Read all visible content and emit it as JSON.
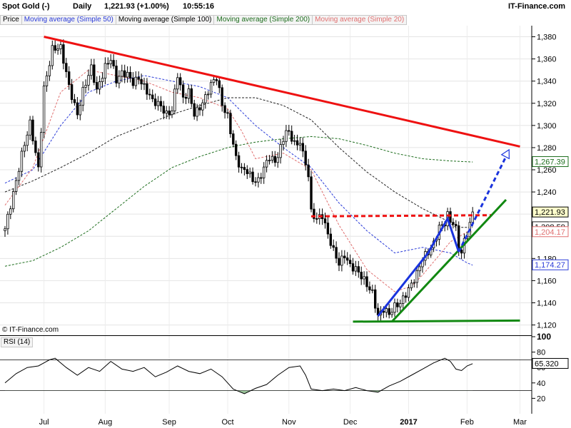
{
  "header": {
    "instrument": "Spot Gold (-)",
    "interval": "Daily",
    "quote": "1,221.93 (+1.00%)",
    "time": "10:55:16",
    "brand": "IT-Finance.com"
  },
  "legend": [
    {
      "label": "Price",
      "color": "#000000"
    },
    {
      "label": "Moving average (Simple 50)",
      "color": "#2a3bd8"
    },
    {
      "label": "Moving average (Simple 100)",
      "color": "#000000"
    },
    {
      "label": "Moving average (Simple 200)",
      "color": "#1e6e1e"
    },
    {
      "label": "Moving average (Simple 20)",
      "color": "#e07070"
    }
  ],
  "copyright": "© IT-Finance.com",
  "rsi_label": "RSI (14)",
  "chart_data": [
    {
      "type": "candlestick",
      "title": "Spot Gold (-) Daily",
      "ylim": [
        1112,
        1390
      ],
      "y_ticks": [
        1120,
        1140,
        1160,
        1180,
        1200,
        1220,
        1240,
        1260,
        1280,
        1300,
        1320,
        1340,
        1360,
        1380
      ],
      "y_tick_labels": [
        "1,120",
        "1,140",
        "1,160",
        "1,180",
        "",
        "",
        "1,240",
        "1,260",
        "1,280",
        "1,300",
        "1,320",
        "1,340",
        "1,360",
        "1,380"
      ],
      "x_labels": [
        {
          "label": "Jul",
          "day": 14
        },
        {
          "label": "Aug",
          "day": 36
        },
        {
          "label": "Sep",
          "day": 59
        },
        {
          "label": "Oct",
          "day": 80
        },
        {
          "label": "Nov",
          "day": 102
        },
        {
          "label": "Dec",
          "day": 124
        },
        {
          "label": "2017",
          "day": 145
        },
        {
          "label": "Feb",
          "day": 166
        },
        {
          "label": "Mar",
          "day": 185
        }
      ],
      "last_day": 168,
      "close_keys": [
        [
          0,
          1205
        ],
        [
          3,
          1240
        ],
        [
          6,
          1275
        ],
        [
          9,
          1300
        ],
        [
          12,
          1260
        ],
        [
          14,
          1335
        ],
        [
          17,
          1370
        ],
        [
          20,
          1368
        ],
        [
          23,
          1335
        ],
        [
          26,
          1312
        ],
        [
          28,
          1332
        ],
        [
          31,
          1350
        ],
        [
          33,
          1330
        ],
        [
          36,
          1355
        ],
        [
          38,
          1362
        ],
        [
          40,
          1340
        ],
        [
          42,
          1345
        ],
        [
          44,
          1345
        ],
        [
          46,
          1340
        ],
        [
          48,
          1345
        ],
        [
          50,
          1335
        ],
        [
          53,
          1320
        ],
        [
          56,
          1318
        ],
        [
          58,
          1312
        ],
        [
          60,
          1315
        ],
        [
          62,
          1345
        ],
        [
          64,
          1322
        ],
        [
          66,
          1330
        ],
        [
          68,
          1312
        ],
        [
          70,
          1318
        ],
        [
          72,
          1325
        ],
        [
          74,
          1335
        ],
        [
          76,
          1342
        ],
        [
          78,
          1320
        ],
        [
          80,
          1310
        ],
        [
          83,
          1270
        ],
        [
          85,
          1258
        ],
        [
          87,
          1258
        ],
        [
          89,
          1252
        ],
        [
          91,
          1252
        ],
        [
          93,
          1262
        ],
        [
          95,
          1270
        ],
        [
          97,
          1265
        ],
        [
          99,
          1280
        ],
        [
          101,
          1298
        ],
        [
          103,
          1290
        ],
        [
          105,
          1280
        ],
        [
          106,
          1285
        ],
        [
          107,
          1272
        ],
        [
          109,
          1255
        ],
        [
          110,
          1222
        ],
        [
          112,
          1218
        ],
        [
          114,
          1220
        ],
        [
          116,
          1200
        ],
        [
          118,
          1185
        ],
        [
          120,
          1175
        ],
        [
          122,
          1185
        ],
        [
          124,
          1175
        ],
        [
          126,
          1170
        ],
        [
          128,
          1162
        ],
        [
          130,
          1155
        ],
        [
          132,
          1150
        ],
        [
          133,
          1140
        ],
        [
          134,
          1130
        ],
        [
          136,
          1135
        ],
        [
          138,
          1128
        ],
        [
          140,
          1135
        ],
        [
          142,
          1140
        ],
        [
          144,
          1150
        ],
        [
          146,
          1158
        ],
        [
          148,
          1165
        ],
        [
          150,
          1178
        ],
        [
          152,
          1185
        ],
        [
          154,
          1195
        ],
        [
          156,
          1210
        ],
        [
          158,
          1212
        ],
        [
          159,
          1218
        ],
        [
          160,
          1212
        ],
        [
          161,
          1210
        ],
        [
          162,
          1205
        ],
        [
          163,
          1190
        ],
        [
          164,
          1185
        ],
        [
          165,
          1198
        ],
        [
          166,
          1205
        ],
        [
          167,
          1212
        ],
        [
          168,
          1222
        ]
      ],
      "series": [
        {
          "name": "Moving average (Simple 50)",
          "color": "#2a3bd8",
          "dash": "3,2",
          "points": [
            [
              0,
              1248
            ],
            [
              10,
              1260
            ],
            [
              20,
              1300
            ],
            [
              30,
              1330
            ],
            [
              40,
              1340
            ],
            [
              50,
              1345
            ],
            [
              60,
              1340
            ],
            [
              70,
              1335
            ],
            [
              80,
              1325
            ],
            [
              90,
              1300
            ],
            [
              100,
              1280
            ],
            [
              110,
              1262
            ],
            [
              120,
              1230
            ],
            [
              130,
              1205
            ],
            [
              140,
              1185
            ],
            [
              150,
              1190
            ],
            [
              160,
              1185
            ],
            [
              166,
              1176
            ],
            [
              168,
              1174
            ]
          ]
        },
        {
          "name": "Moving average (Simple 100)",
          "color": "#222222",
          "dash": "3,2",
          "points": [
            [
              0,
              1240
            ],
            [
              10,
              1250
            ],
            [
              20,
              1262
            ],
            [
              30,
              1275
            ],
            [
              40,
              1290
            ],
            [
              50,
              1300
            ],
            [
              60,
              1310
            ],
            [
              70,
              1318
            ],
            [
              80,
              1325
            ],
            [
              90,
              1325
            ],
            [
              100,
              1318
            ],
            [
              110,
              1305
            ],
            [
              120,
              1280
            ],
            [
              130,
              1258
            ],
            [
              140,
              1240
            ],
            [
              150,
              1225
            ],
            [
              158,
              1215
            ],
            [
              162,
              1208
            ],
            [
              168,
              1208
            ]
          ]
        },
        {
          "name": "Moving average (Simple 200)",
          "color": "#1e6e1e",
          "dash": "3,2",
          "points": [
            [
              0,
              1173
            ],
            [
              10,
              1178
            ],
            [
              20,
              1190
            ],
            [
              30,
              1205
            ],
            [
              40,
              1225
            ],
            [
              50,
              1245
            ],
            [
              60,
              1262
            ],
            [
              70,
              1272
            ],
            [
              80,
              1280
            ],
            [
              90,
              1285
            ],
            [
              100,
              1288
            ],
            [
              110,
              1290
            ],
            [
              120,
              1288
            ],
            [
              130,
              1282
            ],
            [
              140,
              1275
            ],
            [
              150,
              1270
            ],
            [
              160,
              1268
            ],
            [
              168,
              1267
            ]
          ]
        },
        {
          "name": "Moving average (Simple 20)",
          "color": "#e07070",
          "dash": "3,2",
          "points": [
            [
              0,
              1228
            ],
            [
              10,
              1262
            ],
            [
              20,
              1330
            ],
            [
              30,
              1350
            ],
            [
              40,
              1345
            ],
            [
              50,
              1340
            ],
            [
              60,
              1330
            ],
            [
              70,
              1325
            ],
            [
              80,
              1315
            ],
            [
              85,
              1295
            ],
            [
              90,
              1270
            ],
            [
              100,
              1275
            ],
            [
              110,
              1260
            ],
            [
              120,
              1210
            ],
            [
              130,
              1170
            ],
            [
              140,
              1150
            ],
            [
              146,
              1155
            ],
            [
              150,
              1165
            ],
            [
              160,
              1195
            ],
            [
              166,
              1204
            ],
            [
              168,
              1204
            ]
          ]
        }
      ],
      "trendlines": [
        {
          "color": "#ee1111",
          "width": 3,
          "dash": "",
          "points": [
            [
              14,
              1380
            ],
            [
              185,
              1281
            ]
          ]
        },
        {
          "color": "#ee1111",
          "width": 3,
          "dash": "6,4",
          "points": [
            [
              110,
              1218
            ],
            [
              175,
              1219
            ]
          ]
        },
        {
          "color": "#118811",
          "width": 3,
          "dash": "",
          "points": [
            [
              125,
              1123
            ],
            [
              185,
              1124
            ]
          ]
        },
        {
          "color": "#118811",
          "width": 3,
          "dash": "",
          "points": [
            [
              139,
              1123
            ],
            [
              180,
              1233
            ]
          ]
        },
        {
          "color": "#1a33dd",
          "width": 3,
          "dash": "",
          "points": [
            [
              134,
              1128
            ],
            [
              152,
              1185
            ],
            [
              159,
              1216
            ],
            [
              163,
              1186
            ]
          ]
        },
        {
          "color": "#1a33dd",
          "width": 3,
          "dash": "6,4",
          "points": [
            [
              163,
              1186
            ],
            [
              180,
              1272
            ]
          ]
        }
      ],
      "arrow_target": [
        180,
        1273
      ],
      "price_tags": [
        {
          "value": 1267.39,
          "label": "1,267.39",
          "color": "#1e6e1e",
          "bg": "#ffffff",
          "fg": "#1e6e1e"
        },
        {
          "value": 1221.93,
          "label": "1,221.93",
          "color": "#000000",
          "bg": "#ffffcc",
          "fg": "#000000"
        },
        {
          "value": 1208.59,
          "label": "1,208.59",
          "color": "#222222",
          "bg": "#ffffff",
          "fg": "#000000"
        },
        {
          "value": 1204.17,
          "label": "1,204.17",
          "color": "#e07070",
          "bg": "#ffffff",
          "fg": "#e07070"
        },
        {
          "value": 1174.27,
          "label": "1,174.27",
          "color": "#2a3bd8",
          "bg": "#ffffff",
          "fg": "#2a3bd8"
        }
      ]
    },
    {
      "type": "line",
      "title": "RSI (14)",
      "ylim": [
        0,
        100
      ],
      "y_ticks": [
        20,
        40,
        60,
        80,
        100
      ],
      "y_tick_labels": [
        "20",
        "40",
        "60",
        "80",
        "100"
      ],
      "ref_lines": [
        30,
        70
      ],
      "current": {
        "value": 65.32,
        "label": "65.320"
      },
      "points": [
        [
          0,
          40
        ],
        [
          4,
          52
        ],
        [
          8,
          60
        ],
        [
          12,
          62
        ],
        [
          16,
          70
        ],
        [
          18,
          72
        ],
        [
          22,
          60
        ],
        [
          26,
          50
        ],
        [
          30,
          60
        ],
        [
          34,
          55
        ],
        [
          38,
          68
        ],
        [
          42,
          58
        ],
        [
          46,
          55
        ],
        [
          50,
          60
        ],
        [
          54,
          48
        ],
        [
          58,
          54
        ],
        [
          62,
          62
        ],
        [
          66,
          55
        ],
        [
          70,
          52
        ],
        [
          74,
          58
        ],
        [
          78,
          48
        ],
        [
          82,
          32
        ],
        [
          86,
          26
        ],
        [
          90,
          33
        ],
        [
          94,
          38
        ],
        [
          98,
          50
        ],
        [
          102,
          60
        ],
        [
          106,
          62
        ],
        [
          108,
          50
        ],
        [
          110,
          32
        ],
        [
          114,
          30
        ],
        [
          118,
          32
        ],
        [
          122,
          30
        ],
        [
          126,
          34
        ],
        [
          130,
          30
        ],
        [
          134,
          28
        ],
        [
          138,
          36
        ],
        [
          142,
          42
        ],
        [
          146,
          50
        ],
        [
          150,
          58
        ],
        [
          154,
          66
        ],
        [
          158,
          72
        ],
        [
          160,
          68
        ],
        [
          162,
          58
        ],
        [
          164,
          56
        ],
        [
          166,
          62
        ],
        [
          168,
          65
        ]
      ]
    }
  ]
}
